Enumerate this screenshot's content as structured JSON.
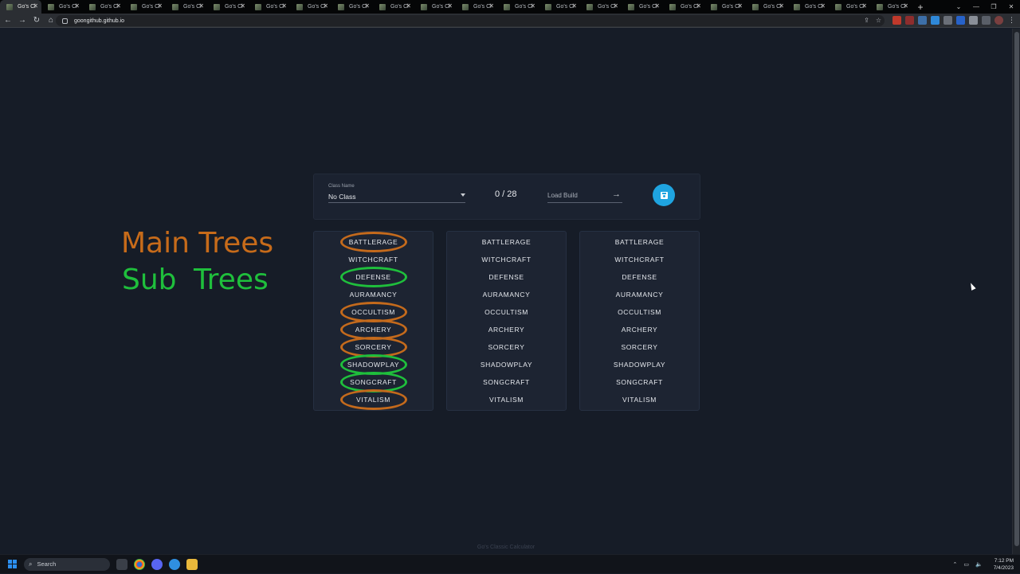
{
  "browser": {
    "tabs": [
      {
        "title": "Go's Cl",
        "active": true
      },
      {
        "title": "Go's Cl"
      },
      {
        "title": "Go's Cl"
      },
      {
        "title": "Go's Cl"
      },
      {
        "title": "Go's Cl"
      },
      {
        "title": "Go's Cl"
      },
      {
        "title": "Go's Cl"
      },
      {
        "title": "Go's Cl"
      },
      {
        "title": "Go's Cl"
      },
      {
        "title": "Go's Cl"
      },
      {
        "title": "Go's Cl"
      },
      {
        "title": "Go's Cl"
      },
      {
        "title": "Go's Cl"
      },
      {
        "title": "Go's Cl"
      },
      {
        "title": "Go's Cl"
      },
      {
        "title": "Go's Cl"
      },
      {
        "title": "Go's Cl"
      },
      {
        "title": "Go's Cl"
      },
      {
        "title": "Go's Cl"
      },
      {
        "title": "Go's Cl"
      },
      {
        "title": "Go's Cl"
      },
      {
        "title": "Go's Cl"
      }
    ],
    "new_tab_label": "+",
    "url": "goongithub.github.io"
  },
  "annotations": {
    "main_trees": "Main Trees",
    "sub_trees": "Sub Trees",
    "main_color": "#c76b1a",
    "sub_color": "#1fbf3c"
  },
  "builder": {
    "class_field": {
      "label": "Class Name",
      "value": "No Class"
    },
    "points": "0 / 28",
    "load_build_placeholder": "Load Build",
    "save_icon": "floppy-disk-icon",
    "save_color": "#1fa4e0"
  },
  "trees": [
    "BATTLERAGE",
    "WITCHCRAFT",
    "DEFENSE",
    "AURAMANCY",
    "OCCULTISM",
    "ARCHERY",
    "SORCERY",
    "SHADOWPLAY",
    "SONGCRAFT",
    "VITALISM"
  ],
  "main_tree_marks": [
    "BATTLERAGE",
    "OCCULTISM",
    "ARCHERY",
    "SORCERY",
    "VITALISM"
  ],
  "sub_tree_marks": [
    "DEFENSE",
    "SHADOWPLAY",
    "SONGCRAFT"
  ],
  "footer": "Go's Classic Calculator",
  "taskbar": {
    "search_label": "Search",
    "time": "7:12 PM",
    "date": "7/4/2023"
  }
}
